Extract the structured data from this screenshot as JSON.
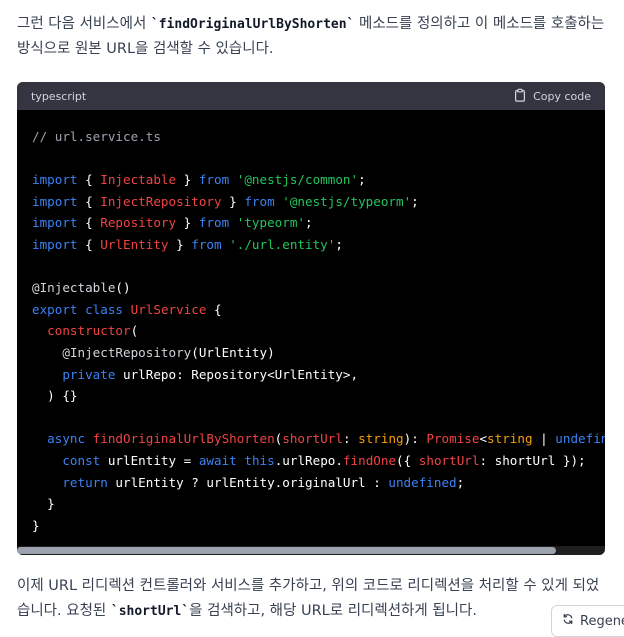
{
  "intro": {
    "before": "그런 다음 서비스에서 ",
    "code": "`findOriginalUrlByShorten`",
    "after": " 메소드를 정의하고 이 메소드를 호출하는 방식으로 원본 URL을 검색할 수 있습니다."
  },
  "codeblock": {
    "language": "typescript",
    "copy_label": "Copy code",
    "lines": [
      [
        [
          "c-comment",
          "// url.service.ts"
        ]
      ],
      [],
      [
        [
          "c-kw",
          "import"
        ],
        [
          "c-plain",
          " { "
        ],
        [
          "c-name",
          "Injectable"
        ],
        [
          "c-plain",
          " } "
        ],
        [
          "c-kw",
          "from"
        ],
        [
          "c-plain",
          " "
        ],
        [
          "c-str",
          "'@nestjs/common'"
        ],
        [
          "c-plain",
          ";"
        ]
      ],
      [
        [
          "c-kw",
          "import"
        ],
        [
          "c-plain",
          " { "
        ],
        [
          "c-name",
          "InjectRepository"
        ],
        [
          "c-plain",
          " } "
        ],
        [
          "c-kw",
          "from"
        ],
        [
          "c-plain",
          " "
        ],
        [
          "c-str",
          "'@nestjs/typeorm'"
        ],
        [
          "c-plain",
          ";"
        ]
      ],
      [
        [
          "c-kw",
          "import"
        ],
        [
          "c-plain",
          " { "
        ],
        [
          "c-name",
          "Repository"
        ],
        [
          "c-plain",
          " } "
        ],
        [
          "c-kw",
          "from"
        ],
        [
          "c-plain",
          " "
        ],
        [
          "c-str",
          "'typeorm'"
        ],
        [
          "c-plain",
          ";"
        ]
      ],
      [
        [
          "c-kw",
          "import"
        ],
        [
          "c-plain",
          " { "
        ],
        [
          "c-name",
          "UrlEntity"
        ],
        [
          "c-plain",
          " } "
        ],
        [
          "c-kw",
          "from"
        ],
        [
          "c-plain",
          " "
        ],
        [
          "c-str",
          "'./url.entity'"
        ],
        [
          "c-plain",
          ";"
        ]
      ],
      [],
      [
        [
          "c-dec",
          "@Injectable"
        ],
        [
          "c-plain",
          "()"
        ]
      ],
      [
        [
          "c-kw",
          "export"
        ],
        [
          "c-plain",
          " "
        ],
        [
          "c-kw",
          "class"
        ],
        [
          "c-plain",
          " "
        ],
        [
          "c-name",
          "UrlService"
        ],
        [
          "c-plain",
          " {"
        ]
      ],
      [
        [
          "c-plain",
          "  "
        ],
        [
          "c-name",
          "constructor"
        ],
        [
          "c-plain",
          "("
        ]
      ],
      [
        [
          "c-plain",
          "    "
        ],
        [
          "c-dec",
          "@InjectRepository"
        ],
        [
          "c-plain",
          "(UrlEntity)"
        ]
      ],
      [
        [
          "c-plain",
          "    "
        ],
        [
          "c-kw",
          "private"
        ],
        [
          "c-plain",
          " urlRepo: Repository<UrlEntity>,"
        ]
      ],
      [
        [
          "c-plain",
          "  ) {}"
        ]
      ],
      [],
      [
        [
          "c-plain",
          "  "
        ],
        [
          "c-kw",
          "async"
        ],
        [
          "c-plain",
          " "
        ],
        [
          "c-name",
          "findOriginalUrlByShorten"
        ],
        [
          "c-plain",
          "("
        ],
        [
          "c-name",
          "shortUrl"
        ],
        [
          "c-plain",
          ": "
        ],
        [
          "c-type",
          "string"
        ],
        [
          "c-plain",
          "): "
        ],
        [
          "c-name",
          "Promise"
        ],
        [
          "c-plain",
          "<"
        ],
        [
          "c-type",
          "string"
        ],
        [
          "c-plain",
          " | "
        ],
        [
          "c-kw",
          "undefined"
        ],
        [
          "c-plain",
          "> {"
        ]
      ],
      [
        [
          "c-plain",
          "    "
        ],
        [
          "c-kw",
          "const"
        ],
        [
          "c-plain",
          " urlEntity = "
        ],
        [
          "c-kw",
          "await"
        ],
        [
          "c-plain",
          " "
        ],
        [
          "c-kw",
          "this"
        ],
        [
          "c-plain",
          ".urlRepo."
        ],
        [
          "c-name",
          "findOne"
        ],
        [
          "c-plain",
          "({ "
        ],
        [
          "c-name",
          "shortUrl"
        ],
        [
          "c-plain",
          ": shortUrl });"
        ]
      ],
      [
        [
          "c-plain",
          "    "
        ],
        [
          "c-kw",
          "return"
        ],
        [
          "c-plain",
          " urlEntity ? urlEntity.originalUrl : "
        ],
        [
          "c-kw",
          "undefined"
        ],
        [
          "c-plain",
          ";"
        ]
      ],
      [
        [
          "c-plain",
          "  }"
        ]
      ],
      [
        [
          "c-plain",
          "}"
        ]
      ]
    ]
  },
  "outro": {
    "line1": "이제 URL 리디렉션 컨트롤러와 서비스를 추가하고, 위의 코드로 리디렉션을 처리할 수 있게 되었습니다. 요청된 ",
    "code": "`shortUrl`",
    "after": "을 검색하고, 해당 URL로 리디렉션하게 됩니다."
  },
  "regenerate_label": "Regenerate"
}
